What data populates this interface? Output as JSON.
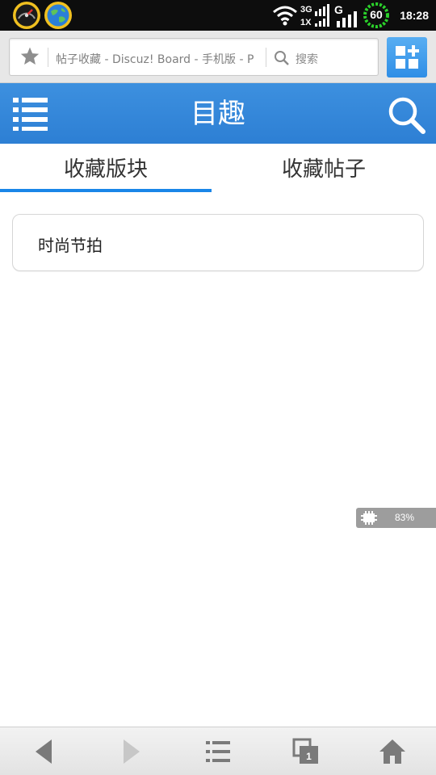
{
  "status_bar": {
    "time": "18:28",
    "network_3g": "3G",
    "network_1x": "1X",
    "network_g": "G",
    "ring_value": "60",
    "icons": [
      "speedometer-icon",
      "globe-icon",
      "wifi-icon",
      "signal-icon",
      "ring-gauge-icon"
    ]
  },
  "browser": {
    "url_text": "帖子收藏 - Discuz! Board - 手机版 - P",
    "search_placeholder": "搜索"
  },
  "app": {
    "title": "目趣"
  },
  "tabs": [
    {
      "label": "收藏版块",
      "active": true
    },
    {
      "label": "收藏帖子",
      "active": false
    }
  ],
  "favorites": [
    {
      "label": "时尚节拍"
    }
  ],
  "memory": {
    "value": "83%"
  },
  "colors": {
    "accent": "#2d7fd4",
    "tab_underline": "#1a86e8",
    "status_bar": "#0d0d0d"
  }
}
